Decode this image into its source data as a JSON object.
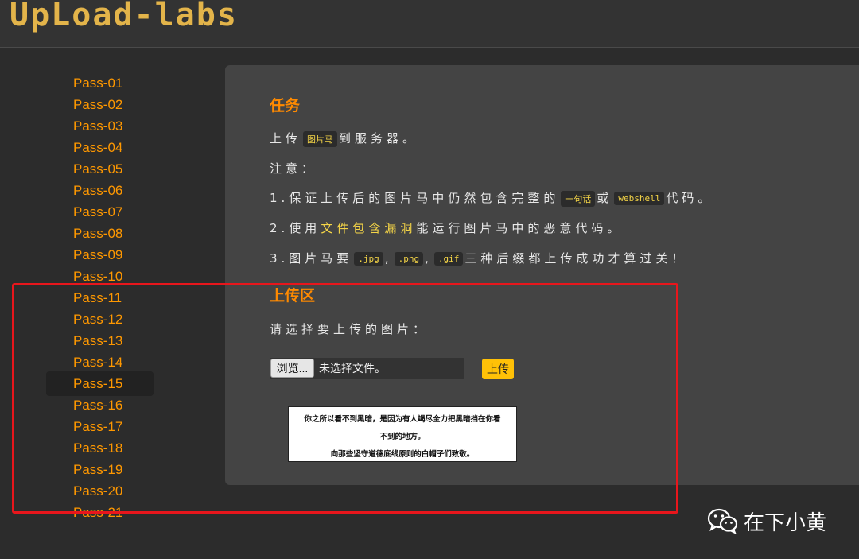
{
  "header": {
    "logo": "UpLoad-labs"
  },
  "sidebar": {
    "active": "Pass-15",
    "items": [
      "Pass-01",
      "Pass-02",
      "Pass-03",
      "Pass-04",
      "Pass-05",
      "Pass-06",
      "Pass-07",
      "Pass-08",
      "Pass-09",
      "Pass-10",
      "Pass-11",
      "Pass-12",
      "Pass-13",
      "Pass-14",
      "Pass-15",
      "Pass-16",
      "Pass-17",
      "Pass-18",
      "Pass-19",
      "Pass-20",
      "Pass-21"
    ]
  },
  "task": {
    "heading": "任务",
    "line1_a": "上传",
    "line1_code": "图片马",
    "line1_b": "到服务器。",
    "notice_label": "注意：",
    "rule1_a": "1.保证上传后的图片马中仍然包含完整的",
    "rule1_code1": "一句话",
    "rule1_mid": "或",
    "rule1_code2": "webshell",
    "rule1_b": "代码。",
    "rule2_a": "2.使用",
    "rule2_hl": "文件包含漏洞",
    "rule2_b": "能运行图片马中的恶意代码。",
    "rule3_a": "3.图片马要",
    "rule3_code1": ".jpg",
    "rule3_sep": ",",
    "rule3_code2": ".png",
    "rule3_code3": ".gif",
    "rule3_b": "三种后缀都上传成功才算过关！"
  },
  "upload": {
    "heading": "上传区",
    "prompt": "请选择要上传的图片：",
    "browse_label": "浏览...",
    "no_file": "未选择文件。",
    "submit_label": "上传"
  },
  "notice_image": {
    "line1": "你之所以看不到黑暗，是因为有人竭尽全力把黑暗挡在你看",
    "line2": "不到的地方。",
    "line3": "向那些坚守道德底线原则的白帽子们致敬。"
  },
  "watermark": {
    "text": "在下小黄",
    "icon": "wechat-icon"
  }
}
